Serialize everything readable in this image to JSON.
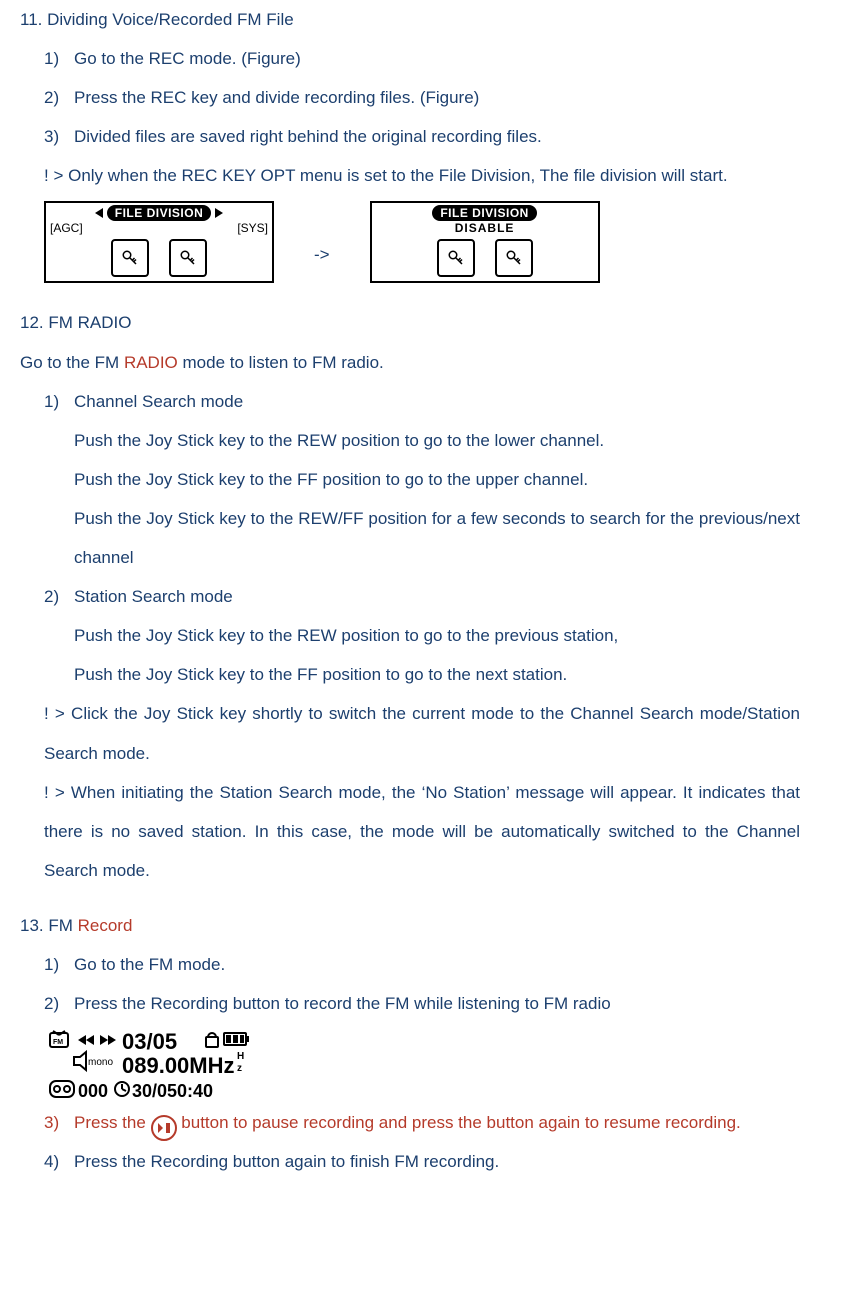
{
  "section11": {
    "title": "11. Dividing Voice/Recorded FM File",
    "s1_num": "1)",
    "s1": "Go to the REC mode. (Figure)",
    "s2_num": "2)",
    "s2": "Press the REC key and divide recording files. (Figure)",
    "s3_num": "3)",
    "s3": "Divided files are saved right behind the original recording files.",
    "note1": "! > Only when the REC KEY OPT menu is set to the File Division, The file division will start."
  },
  "fig1": {
    "pill": "FILE DIVISION",
    "agc": "[AGC]",
    "sys": "[SYS]",
    "arrow": "->",
    "disable": "DISABLE"
  },
  "section12": {
    "title": "12. FM RADIO",
    "intro_a": "Go to the FM ",
    "intro_r": "RADIO",
    "intro_b": " mode to listen to FM radio.",
    "s1_num": "1)",
    "s1": "Channel Search mode",
    "s1a": "Push the Joy Stick key to the REW position to go to the lower channel.",
    "s1b": "Push the Joy Stick key to the FF position to go to the upper channel.",
    "s1c": "Push the Joy Stick key to the REW/FF position for a few seconds to search for the previous/next channel",
    "s2_num": "2)",
    "s2": "Station Search mode",
    "s2a": "Push the Joy Stick key to the REW position to go to the previous station,",
    "s2b": "Push the Joy Stick key to the FF position to go to the next station.",
    "note1": "! > Click the Joy Stick key shortly to switch the current mode to the Channel Search mode/Station Search mode.",
    "note2": "! > When initiating the Station Search mode, the ‘No Station’ message will appear. It indicates that there is no saved station. In this case, the mode will be automatically switched to the Channel Search mode."
  },
  "section13": {
    "title_a": "13. FM ",
    "title_r": "Record",
    "s1_num": "1)",
    "s1": "Go to the FM mode.",
    "s2_num": "2)",
    "s2": "Press the Recording button to record the FM while listening to FM radio",
    "s3_num": "3)",
    "s3a": "Press the ",
    "s3b": " button to pause recording and press the button again to resume recording.",
    "s4_num": "4)",
    "s4": "Press the Recording button again to finish FM recording."
  },
  "fmlcd": {
    "track": "03/05",
    "mono": "mono",
    "freq": "089.00MHz",
    "count": "000",
    "time": "30/050:40",
    "h_txt": "H",
    "z_txt": "z"
  }
}
